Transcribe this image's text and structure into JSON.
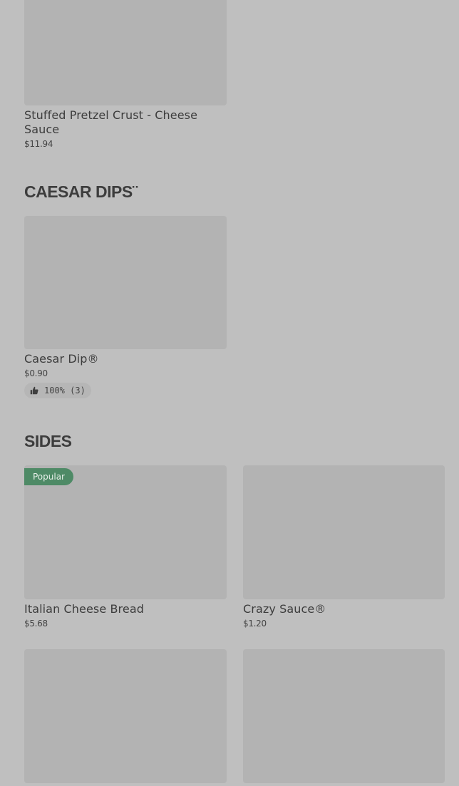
{
  "sections": {
    "pretzel": {
      "items": [
        {
          "name": "Stuffed Pretzel Crust - Cheese Sauce",
          "price": "$11.94"
        }
      ]
    },
    "caesar_dips": {
      "title": "CAESAR DIPS¨",
      "items": [
        {
          "name": "Caesar Dip®",
          "price": "$0.90",
          "rating": "100% (3)"
        }
      ]
    },
    "sides": {
      "title": "SIDES",
      "items": [
        {
          "name": "Italian Cheese Bread",
          "price": "$5.68",
          "badge": "Popular"
        },
        {
          "name": "Crazy Sauce®",
          "price": "$1.20"
        },
        {
          "name": "",
          "price": ""
        },
        {
          "name": "",
          "price": ""
        }
      ]
    }
  },
  "colors": {
    "background": "#bfbfbf",
    "image_placeholder": "#b3b3b3",
    "badge": "#4e8a66",
    "rating_pill": "#b6b6b6"
  },
  "icons": {
    "rating": "thumbs-up-icon"
  }
}
